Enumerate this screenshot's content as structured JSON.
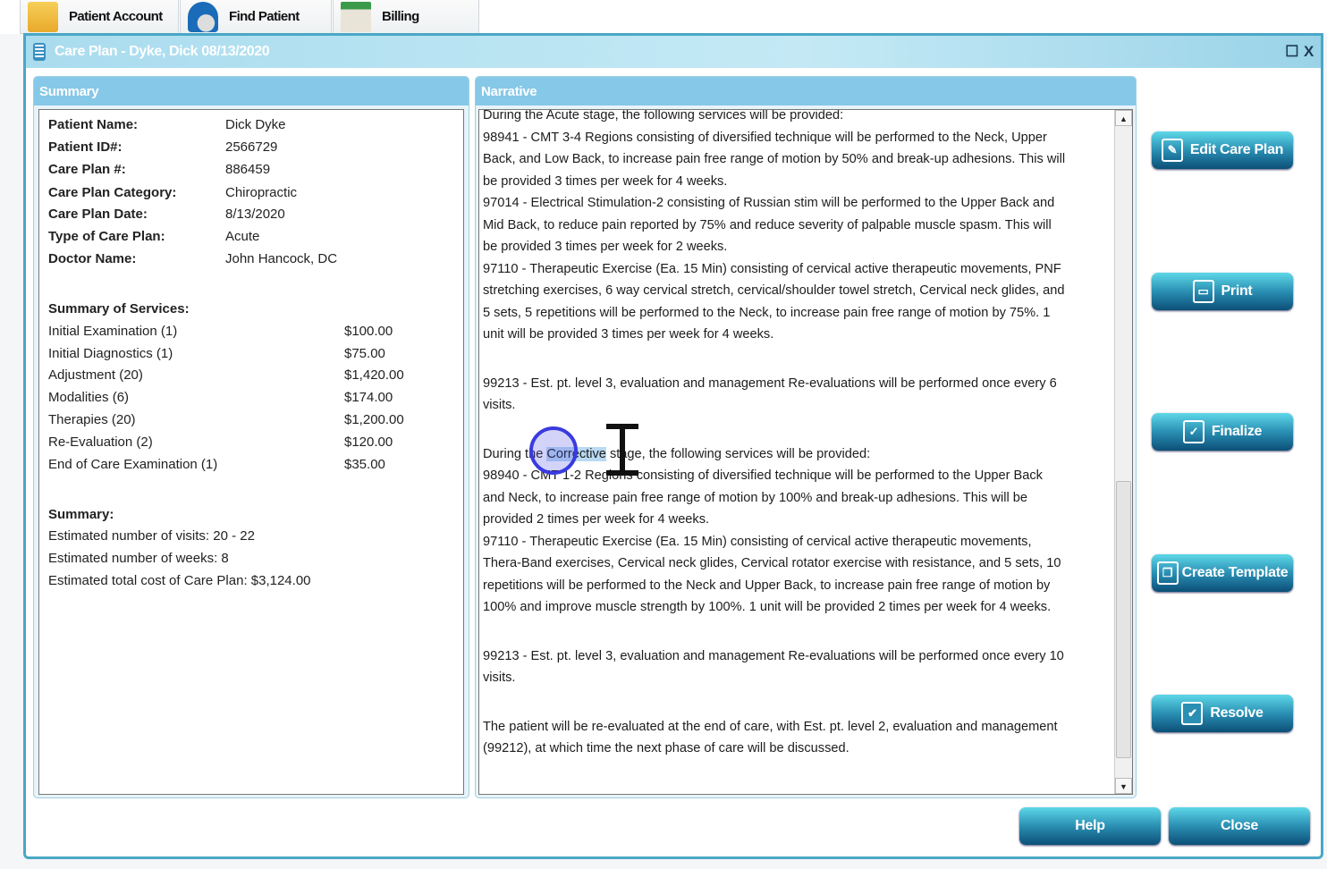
{
  "tabs": [
    {
      "label": "Patient Account",
      "icon": "person-icon"
    },
    {
      "label": "Find Patient",
      "icon": "find-person-icon"
    },
    {
      "label": "Billing",
      "icon": "billing-icon"
    }
  ],
  "window": {
    "title": "Care Plan -  Dyke, Dick 08/13/2020",
    "controls": [
      "☐",
      "X"
    ]
  },
  "summary": {
    "header": "Summary",
    "fields": [
      {
        "label": "Patient Name:",
        "value": "Dick Dyke"
      },
      {
        "label": "Patient ID#:",
        "value": "2566729"
      },
      {
        "label": "Care Plan #:",
        "value": "886459"
      },
      {
        "label": "Care Plan Category:",
        "value": "Chiropractic"
      },
      {
        "label": "Care Plan Date:",
        "value": "8/13/2020"
      },
      {
        "label": "Type of Care Plan:",
        "value": "Acute"
      },
      {
        "label": "Doctor Name:",
        "value": "John Hancock, DC"
      }
    ],
    "services_title": "Summary of Services:",
    "services": [
      {
        "name": "Initial Examination (1)",
        "price": "$100.00"
      },
      {
        "name": "Initial Diagnostics (1)",
        "price": "$75.00"
      },
      {
        "name": "Adjustment  (20)",
        "price": "$1,420.00"
      },
      {
        "name": "Modalities  (6)",
        "price": "$174.00"
      },
      {
        "name": "Therapies  (20)",
        "price": "$1,200.00"
      },
      {
        "name": "Re-Evaluation  (2)",
        "price": "$120.00"
      },
      {
        "name": "End of Care Examination  (1)",
        "price": "$35.00"
      }
    ],
    "summary_title": "Summary:",
    "summary_lines": [
      "Estimated number of visits:  20 - 22",
      "Estimated number of weeks:  8",
      "Estimated total cost of Care Plan:  $3,124.00"
    ]
  },
  "narrative": {
    "header": "Narrative",
    "lines": [
      "During the Acute stage, the following services will be provided:",
      "98941 - CMT 3-4 Regions consisting of diversified technique will be performed to the Neck, Upper",
      "Back, and Low Back, to increase pain free range of motion by 50% and break-up adhesions.  This will",
      "be provided 3 times per week for 4 weeks.",
      "97014 - Electrical Stimulation-2 consisting of Russian stim will be performed to the Upper Back and",
      "Mid Back, to reduce pain reported by 75% and reduce severity of palpable muscle spasm.  This will",
      "be provided 3 times per week for 2 weeks.",
      "97110 - Therapeutic Exercise (Ea. 15 Min) consisting of cervical active therapeutic movements, PNF",
      "stretching exercises, 6 way cervical stretch, cervical/shoulder towel stretch, Cervical neck glides, and",
      "5 sets, 5 repetitions will be performed to the Neck, to increase pain free range of motion by 75%.  1",
      "unit will be provided 3 times per week for 4 weeks.",
      "",
      "99213 - Est. pt. level 3, evaluation and management Re-evaluations will be performed once every 6",
      "visits.",
      "",
      "During the Corrective stage, the following services will be provided:",
      "98940 - CMT 1-2 Regions consisting of diversified technique will be performed to the Upper Back",
      "and Neck, to increase pain free range of motion by 100% and break-up adhesions.  This will be",
      "provided 2 times per week for 4 weeks.",
      "97110 - Therapeutic Exercise (Ea. 15 Min) consisting of cervical active therapeutic movements,",
      "Thera-Band exercises, Cervical neck glides, Cervical rotator exercise with resistance, and 5 sets, 10",
      "repetitions will be performed to the Neck and Upper Back, to increase pain free range of motion by",
      "100% and improve muscle strength by 100%.  1 unit will be provided 2 times per week for 4 weeks.",
      "",
      "99213 - Est. pt. level 3, evaluation and management Re-evaluations will be performed once every 10",
      "visits.",
      "",
      "The patient will be re-evaluated at the end of care, with Est. pt. level 2, evaluation and management",
      "(99212), at which time the next phase of care will be discussed."
    ],
    "selected_word": "Corrective"
  },
  "actions": [
    {
      "label": "Edit Care Plan",
      "icon": "edit-document-icon"
    },
    {
      "label": "Print",
      "icon": "printer-icon"
    },
    {
      "label": "Finalize",
      "icon": "checkbox-icon"
    },
    {
      "label": "Create Template",
      "icon": "copy-document-icon"
    },
    {
      "label": "Resolve",
      "icon": "checkmark-icon"
    }
  ],
  "footer": {
    "help": "Help",
    "close": "Close"
  }
}
